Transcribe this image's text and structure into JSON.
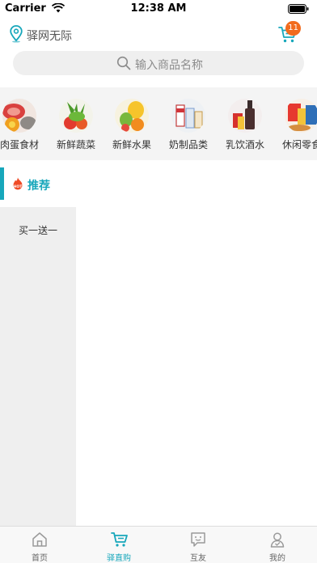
{
  "status_bar": {
    "carrier": "Carrier",
    "time": "12:38 AM"
  },
  "header": {
    "location": "驿网无际",
    "cart_count": "11",
    "location_icon": "location-pin-icon",
    "cart_icon": "cart-icon"
  },
  "search": {
    "placeholder": "输入商品名称"
  },
  "categories": [
    {
      "label": "肉蛋食材"
    },
    {
      "label": "新鲜蔬菜"
    },
    {
      "label": "新鲜水果"
    },
    {
      "label": "奶制品类"
    },
    {
      "label": "乳饮酒水"
    },
    {
      "label": "休闲零食"
    }
  ],
  "recommend": {
    "label": "推荐",
    "badge": "HOT"
  },
  "left_menu": {
    "items": [
      "买一送一"
    ]
  },
  "tab_bar": {
    "items": [
      {
        "label": "首页",
        "icon": "home-icon"
      },
      {
        "label": "驿直购",
        "icon": "cart-icon"
      },
      {
        "label": "互友",
        "icon": "chat-icon"
      },
      {
        "label": "我的",
        "icon": "user-icon"
      }
    ],
    "active_index": 1
  },
  "colors": {
    "accent": "#17a7bb",
    "badge": "#f26b1d",
    "background_strip": "#f4f4f4"
  }
}
